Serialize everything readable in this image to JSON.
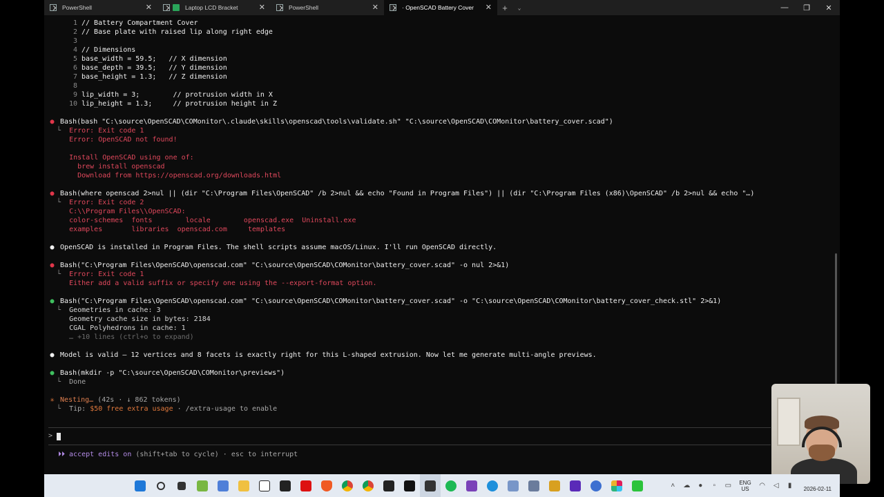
{
  "tabs": [
    {
      "label": "PowerShell",
      "icon": "powershell-icon",
      "active": false
    },
    {
      "label": "Laptop LCD Bracket",
      "icon": "green-app-icon",
      "active": false
    },
    {
      "label": "PowerShell",
      "icon": "powershell-icon",
      "active": false
    },
    {
      "label": "· OpenSCAD Battery Cover",
      "icon": "powershell-icon",
      "active": true
    }
  ],
  "window_controls": {
    "add": "+",
    "menu": "⌄",
    "minimize": "—",
    "maximize": "❐",
    "close": "✕"
  },
  "code": [
    {
      "n": "1",
      "text": "// Battery Compartment Cover"
    },
    {
      "n": "2",
      "text": "// Base plate with raised lip along right edge"
    },
    {
      "n": "3",
      "text": ""
    },
    {
      "n": "4",
      "text": "// Dimensions"
    },
    {
      "n": "5",
      "text": "base_width = 59.5;   // X dimension"
    },
    {
      "n": "6",
      "text": "base_depth = 39.5;   // Y dimension"
    },
    {
      "n": "7",
      "text": "base_height = 1.3;   // Z dimension"
    },
    {
      "n": "8",
      "text": ""
    },
    {
      "n": "9",
      "text": "lip_width = 3;        // protrusion width in X"
    },
    {
      "n": "10",
      "text": "lip_height = 1.3;     // protrusion height in Z"
    }
  ],
  "blocks": {
    "b1": {
      "cmd": "Bash(bash \"C:\\source\\OpenSCAD\\COMonitor\\.claude\\skills\\openscad\\tools\\validate.sh\" \"C:\\source\\OpenSCAD\\COMonitor\\battery_cover.scad\")",
      "l1": "Error: Exit code 1",
      "l2": "Error: OpenSCAD not found!",
      "l3": "Install OpenSCAD using one of:",
      "l4": "  brew install openscad",
      "l5": "  Download from https://openscad.org/downloads.html"
    },
    "b2": {
      "cmd": "Bash(where openscad 2>nul || (dir \"C:\\Program Files\\OpenSCAD\" /b 2>nul && echo \"Found in Program Files\") || (dir \"C:\\Program Files (x86)\\OpenSCAD\" /b 2>nul && echo \"…)",
      "l1": "Error: Exit code 2",
      "l2": "C:\\\\Program Files\\\\OpenSCAD:",
      "l3": "color-schemes  fonts        locale        openscad.exe  Uninstall.exe",
      "l4": "examples       libraries  openscad.com     templates"
    },
    "m1": "OpenSCAD is installed in Program Files. The shell scripts assume macOS/Linux. I'll run OpenSCAD directly.",
    "b3": {
      "cmd": "Bash(\"C:\\Program Files\\OpenSCAD\\openscad.com\" \"C:\\source\\OpenSCAD\\COMonitor\\battery_cover.scad\" -o nul 2>&1)",
      "l1": "Error: Exit code 1",
      "l2": "Either add a valid suffix or specify one using the --export-format option."
    },
    "b4": {
      "cmd": "Bash(\"C:\\Program Files\\OpenSCAD\\openscad.com\" \"C:\\source\\OpenSCAD\\COMonitor\\battery_cover.scad\" -o \"C:\\source\\OpenSCAD\\COMonitor\\battery_cover_check.stl\" 2>&1)",
      "l1": "Geometries in cache: 3",
      "l2": "Geometry cache size in bytes: 2184",
      "l3": "CGAL Polyhedrons in cache: 1",
      "l4": "… +10 lines (ctrl+o to expand)"
    },
    "m2": "Model is valid — 12 vertices and 8 facets is exactly right for this L-shaped extrusion. Now let me generate multi-angle previews.",
    "b5": {
      "cmd": "Bash(mkdir -p \"C:\\source\\OpenSCAD\\COMonitor\\previews\")",
      "l1": "Done"
    },
    "status": {
      "star": "✳",
      "label": "Nesting…",
      "meta": "(42s · ↓ 862 tokens)",
      "tip_prefix": "Tip: ",
      "tip_offer": "$50 free extra usage",
      "tip_rest": " · /extra-usage to enable"
    }
  },
  "tree_glyph": "└",
  "prompt_symbol": ">",
  "footer": {
    "arrows": "⏵⏵",
    "mode": "accept edits on",
    "rest": " (shift+tab to cycle) · esc to interrupt"
  },
  "colors": {
    "error_bullet": "#e0364a",
    "success_bullet": "#3fbf5f",
    "error_text": "#e0485c",
    "accent_purple": "#b48ce8",
    "status_orange": "#e0783c"
  },
  "taskbar": {
    "icons": [
      "start-icon",
      "search-icon",
      "task-view-icon",
      "file-icon",
      "store-icon",
      "folder-icon",
      "notion-icon",
      "calendar-icon",
      "red-l-icon",
      "brave-icon",
      "chrome-icon",
      "chrome-2-icon",
      "x-icon",
      "terminal-icon",
      "terminal-2-icon",
      "spotify-icon",
      "visual-studio-icon",
      "edge-icon",
      "network-icon",
      "network-2-icon",
      "app-icon",
      "app-2-icon",
      "circle-app-icon",
      "slack-icon",
      "green-app-icon"
    ],
    "lang_top": "ENG",
    "lang_bottom": "US",
    "date": "2026-02-11"
  }
}
